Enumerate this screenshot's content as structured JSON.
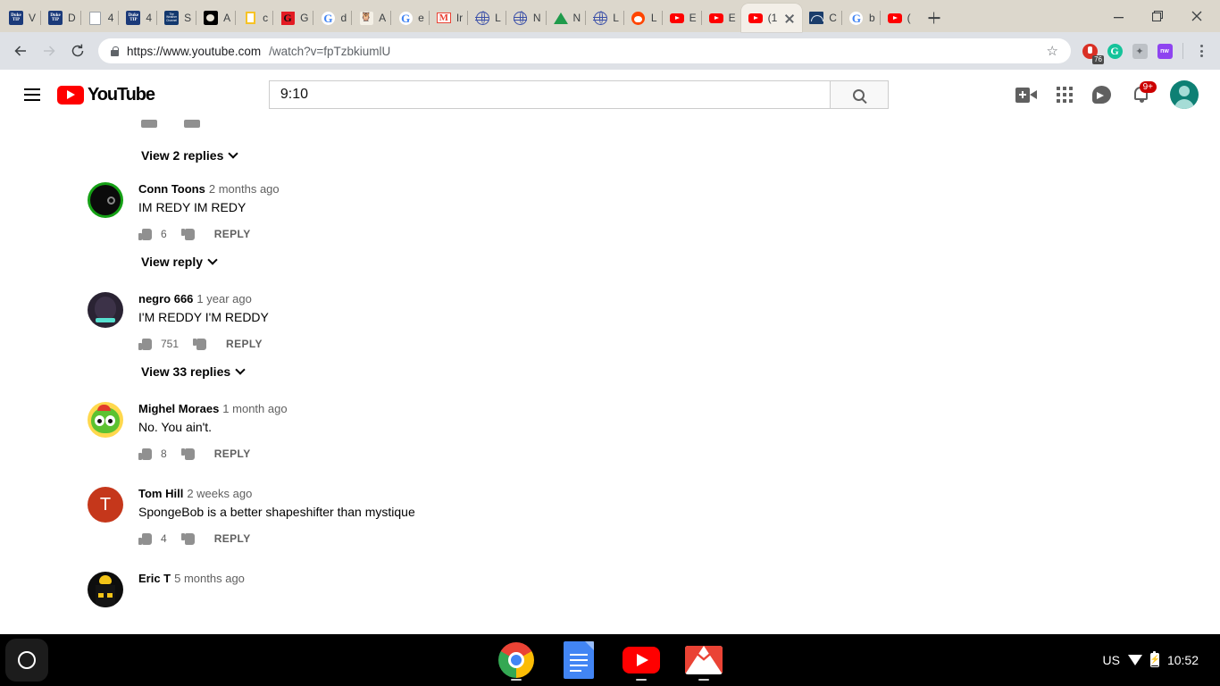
{
  "browser": {
    "tabs": [
      {
        "label": "V",
        "icon": "duke-tip-icon"
      },
      {
        "label": "D",
        "icon": "duke-tip-icon"
      },
      {
        "label": "4",
        "icon": "document-icon"
      },
      {
        "label": "4",
        "icon": "duke-tip-icon"
      },
      {
        "label": "S",
        "icon": "weather-channel-icon"
      },
      {
        "label": "A",
        "icon": "space-photo-icon"
      },
      {
        "label": "c",
        "icon": "yellow-box-icon"
      },
      {
        "label": "G",
        "icon": "red-g-icon"
      },
      {
        "label": "d",
        "icon": "google-icon"
      },
      {
        "label": "A",
        "icon": "owl-face-icon"
      },
      {
        "label": "e",
        "icon": "google-icon"
      },
      {
        "label": "Ir",
        "icon": "gmail-icon"
      },
      {
        "label": "L",
        "icon": "globe-icon"
      },
      {
        "label": "N",
        "icon": "globe-icon"
      },
      {
        "label": "N",
        "icon": "green-triangle-icon"
      },
      {
        "label": "L",
        "icon": "globe-icon"
      },
      {
        "label": "L",
        "icon": "reddit-icon"
      },
      {
        "label": "E",
        "icon": "youtube-icon"
      },
      {
        "label": "E",
        "icon": "youtube-icon"
      }
    ],
    "active_tab": {
      "label": "(1",
      "icon": "youtube-icon"
    },
    "tabs_after": [
      {
        "label": "C",
        "icon": "bridge-icon"
      },
      {
        "label": "b",
        "icon": "google-icon"
      },
      {
        "label": "(",
        "icon": "youtube-icon"
      }
    ],
    "new_tab_label": "+",
    "window_controls": {
      "minimize": "—",
      "maximize": "❐",
      "close": "✕"
    },
    "toolbar": {
      "back": "←",
      "forward": "→",
      "reload": "⟳",
      "url_secure": "https://www.youtube.com",
      "url_path": "/watch?v=fpTzbkiumlU",
      "bookmark_star": "☆",
      "extensions": [
        {
          "name": "extension-red",
          "badge": "76"
        },
        {
          "name": "grammarly-extension",
          "glyph": "G"
        },
        {
          "name": "accessibility-extension",
          "glyph": "✦"
        },
        {
          "name": "nw-extension",
          "glyph": "nw"
        }
      ],
      "menu": "kebab-menu"
    }
  },
  "youtube": {
    "menu_icon": "hamburger-menu-icon",
    "logo_text": "YouTube",
    "search": {
      "value": "9:10",
      "placeholder": "Search"
    },
    "header_icons": [
      {
        "name": "create-video-icon"
      },
      {
        "name": "apps-grid-icon"
      },
      {
        "name": "messages-icon"
      },
      {
        "name": "notifications-bell-icon",
        "badge": "9+"
      },
      {
        "name": "account-avatar"
      }
    ]
  },
  "comments": {
    "top_view_replies": "View 2 replies",
    "items": [
      {
        "author": "Conn Toons",
        "time": "2 months ago",
        "text": "IM REDY IM REDY",
        "likes": "6",
        "reply_label": "REPLY",
        "view_replies": "View reply",
        "avatar": "conn-toons-avatar"
      },
      {
        "author": "negro 666",
        "time": "1 year ago",
        "text": "I'M REDDY I'M REDDY",
        "likes": "751",
        "reply_label": "REPLY",
        "view_replies": "View 33 replies",
        "avatar": "negro-666-avatar"
      },
      {
        "author": "Mighel Moraes",
        "time": "1 month ago",
        "text": "No. You ain't.",
        "likes": "8",
        "reply_label": "REPLY",
        "view_replies": "",
        "avatar": "mighel-moraes-avatar"
      },
      {
        "author": "Tom Hill",
        "time": "2 weeks ago",
        "text": "SpongeBob is a better shapeshifter than mystique",
        "likes": "4",
        "reply_label": "REPLY",
        "view_replies": "",
        "avatar": "tom-hill-avatar",
        "avatar_letter": "T"
      },
      {
        "author": "Eric T",
        "time": "5 months ago",
        "text": "",
        "likes": "",
        "reply_label": "",
        "view_replies": "",
        "avatar": "eric-t-avatar"
      }
    ]
  },
  "shelf": {
    "launcher": "launcher-button",
    "apps": [
      {
        "name": "chrome-app",
        "running": true
      },
      {
        "name": "google-docs-app",
        "running": false
      },
      {
        "name": "youtube-app",
        "running": true
      },
      {
        "name": "gmail-app",
        "running": true
      }
    ],
    "status": {
      "locale": "US",
      "wifi": "wifi-icon",
      "battery": "battery-charging-icon",
      "time": "10:52"
    }
  },
  "colors": {
    "youtube_red": "#ff0000",
    "chrome_toolbar": "#dee1e6",
    "tabstrip": "#dcd7cc",
    "link_blue": "#065fd4",
    "avatar_teal": "#0e8074",
    "shelf_black": "#000000"
  }
}
